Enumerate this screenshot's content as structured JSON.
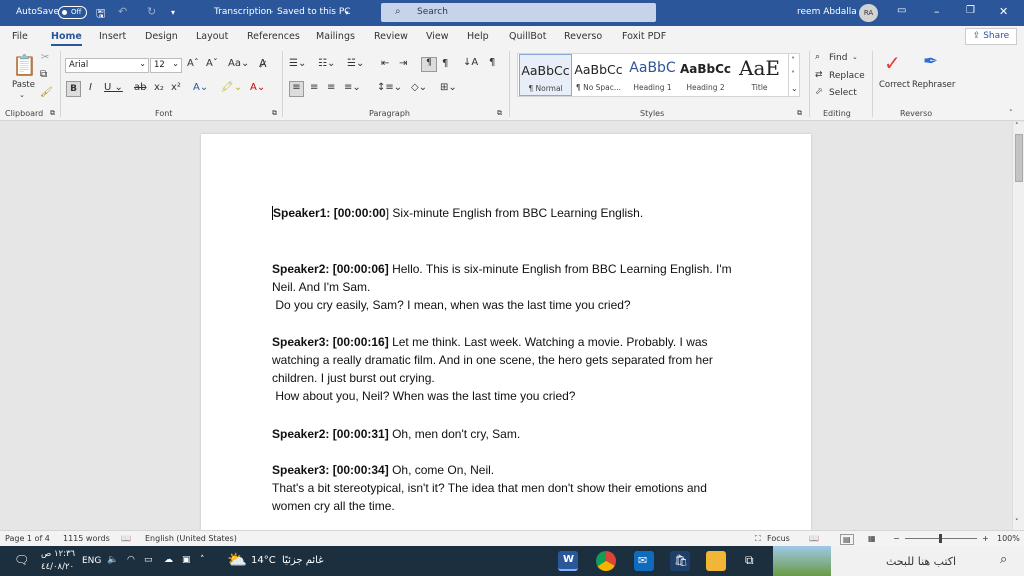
{
  "titlebar": {
    "autosave_label": "AutoSave",
    "autosave_state": "Off",
    "doc_title": "Transcription",
    "save_status": "Saved to this PC",
    "search_placeholder": "Search",
    "user_name": "reem Abdalla",
    "user_initials": "RA",
    "accent_color": "#2b579a"
  },
  "tabs": [
    "File",
    "Home",
    "Insert",
    "Design",
    "Layout",
    "References",
    "Mailings",
    "Review",
    "View",
    "Help",
    "QuillBot",
    "Reverso",
    "Foxit PDF"
  ],
  "share_label": "Share",
  "ribbon": {
    "clipboard": {
      "paste_label": "Paste",
      "group_label": "Clipboard"
    },
    "font": {
      "font_name": "Arial",
      "font_size": "12",
      "group_label": "Font"
    },
    "paragraph": {
      "group_label": "Paragraph"
    },
    "styles": {
      "group_label": "Styles",
      "items": [
        {
          "preview": "AaBbCc",
          "name": "¶ Normal"
        },
        {
          "preview": "AaBbCc",
          "name": "¶ No Spac..."
        },
        {
          "preview": "AaBbC",
          "name": "Heading 1"
        },
        {
          "preview": "AaBbCc",
          "name": "Heading 2"
        },
        {
          "preview": "AaE",
          "name": "Title"
        }
      ]
    },
    "editing": {
      "find": "Find",
      "replace": "Replace",
      "select": "Select",
      "group_label": "Editing"
    },
    "reverso": {
      "correct": "Correct",
      "rephraser": "Rephraser",
      "group_label": "Reverso"
    }
  },
  "document": {
    "paragraphs": [
      {
        "speaker": "Speaker1: [00:00:00",
        "text": "] Six-minute English from BBC Learning English."
      },
      {
        "speaker": "Speaker2: [00:00:06]",
        "text": " Hello. This is six-minute English from BBC Learning English. I'm Neil. And I'm Sam.",
        "cont": " Do you cry easily, Sam? I mean, when was the last time you cried?"
      },
      {
        "speaker": "Speaker3: [00:00:16]",
        "text": " Let me think. Last week. Watching a movie. Probably. I was watching a really dramatic film. And in one scene, the hero gets separated from her children. I just burst out crying.",
        "cont": " How about you, Neil? When was the last time you cried?"
      },
      {
        "speaker": "Speaker2: [00:00:31]",
        "text": " Oh, men don't cry, Sam."
      },
      {
        "speaker": "Speaker3: [00:00:34]",
        "text": " Oh, come On, Neil.",
        "cont": "That's a bit stereotypical, isn't it? The idea that men don't show their emotions and women cry all the time."
      }
    ]
  },
  "status": {
    "page": "Page 1 of 4",
    "words": "1115 words",
    "language": "English (United States)",
    "focus": "Focus",
    "zoom": "100%",
    "zoom_level": 1.0
  },
  "taskbar": {
    "time": "١٢:٣٦ ص",
    "date": "٤٤/٠٨/٢٠",
    "lang": "ENG",
    "weather_temp": "14°C",
    "weather_text": "غائم جزئيًا",
    "search_placeholder": "اكتب هنا للبحث"
  }
}
